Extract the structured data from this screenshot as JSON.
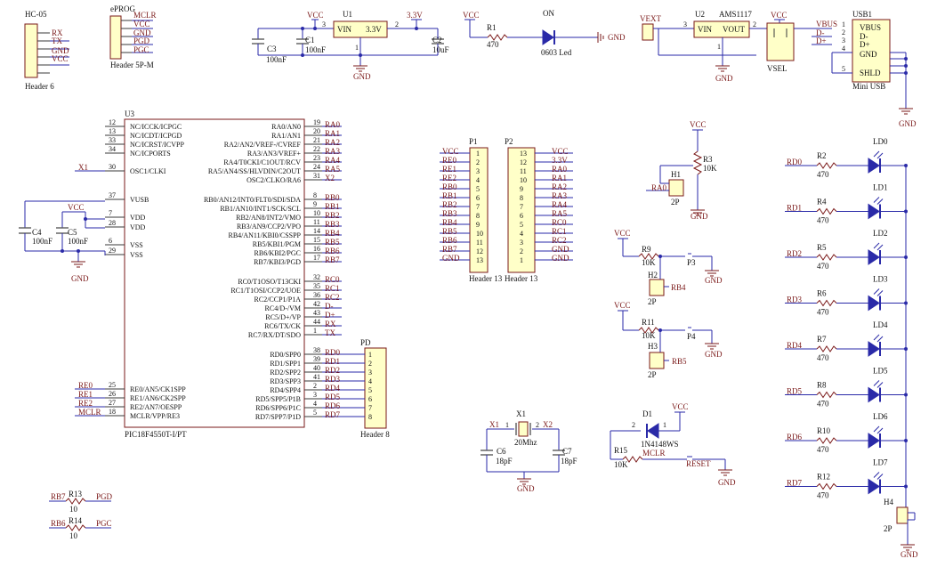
{
  "colors": {
    "wire": "#2a2aa8",
    "label": "#7a1818",
    "body": "#ffffc8",
    "background": "#ffffff"
  },
  "hc05": {
    "des": "HC-05",
    "name": "Header 6",
    "pins": [
      "RX",
      "TX",
      "GND",
      "VCC"
    ]
  },
  "eprog": {
    "des": "ePROG",
    "name": "Header 5P-M",
    "pins": [
      "MCLR",
      "VCC",
      "GND",
      "PGD",
      "PGC"
    ]
  },
  "power": {
    "vcc": "VCC",
    "gnd": "GND",
    "v33": "3.3V",
    "u1": {
      "des": "U1",
      "vin": "VIN",
      "vout": "3.3V",
      "pin_in": "3",
      "pin_out": "2",
      "pin_gnd": "1"
    },
    "c3": {
      "des": "C3",
      "val": "100nF"
    },
    "c1": {
      "des": "C1",
      "val": "100nF"
    },
    "c2": {
      "des": "C2",
      "val": "10uF"
    },
    "r1": {
      "des": "R1",
      "val": "470"
    },
    "on_led": {
      "des": "ON",
      "val": "0603 Led"
    },
    "vext": "VEXT",
    "u2": {
      "des": "U2",
      "part": "AMS1117",
      "vin": "VIN",
      "vout": "VOUT",
      "pin_in": "3",
      "pin_out": "2",
      "pin_gnd": "1"
    },
    "vsel": "VSEL",
    "vbus": "VBUS",
    "dminus": "D-",
    "dplus": "D+"
  },
  "usb": {
    "des": "USB1",
    "name": "Mini USB",
    "pins": [
      "VBUS",
      "D-",
      "D+",
      "GND",
      "SHLD"
    ],
    "pin_nums": [
      "1",
      "2",
      "3",
      "4",
      "5"
    ]
  },
  "mcu": {
    "des": "U3",
    "part": "PIC18F4550T-I/PT",
    "left_pins": [
      {
        "num": "12",
        "name": "NC/ICCK/ICPGC",
        "net": ""
      },
      {
        "num": "13",
        "name": "NC/ICDT/ICPGD",
        "net": ""
      },
      {
        "num": "33",
        "name": "NC/ICRST/ICVPP",
        "net": ""
      },
      {
        "num": "34",
        "name": "NC/ICPORTS",
        "net": ""
      },
      {
        "num": "30",
        "name": "OSC1/CLKI",
        "net": "X1"
      },
      {
        "num": "37",
        "name": "VUSB",
        "net": ""
      },
      {
        "num": "7",
        "name": "VDD",
        "net": ""
      },
      {
        "num": "28",
        "name": "VDD",
        "net": ""
      },
      {
        "num": "6",
        "name": "VSS",
        "net": ""
      },
      {
        "num": "29",
        "name": "VSS",
        "net": ""
      },
      {
        "num": "25",
        "name": "RE0/AN5/CK1SPP",
        "net": "RE0"
      },
      {
        "num": "26",
        "name": "RE1/AN6/CK2SPP",
        "net": "RE1"
      },
      {
        "num": "27",
        "name": "RE2/AN7/OESPP",
        "net": "RE2"
      },
      {
        "num": "18",
        "name": "MCLR/VPP/RE3",
        "net": "MCLR"
      }
    ],
    "right_pins": [
      {
        "num": "19",
        "name": "RA0/AN0",
        "net": "RA0"
      },
      {
        "num": "20",
        "name": "RA1/AN1",
        "net": "RA1"
      },
      {
        "num": "21",
        "name": "RA2/AN2/VREF-/CVREF",
        "net": "RA2"
      },
      {
        "num": "22",
        "name": "RA3/AN3/VREF+",
        "net": "RA3"
      },
      {
        "num": "23",
        "name": "RA4/T0CKI/C1OUT/RCV",
        "net": "RA4"
      },
      {
        "num": "24",
        "name": "RA5/AN4/SS/HLVDIN/C2OUT",
        "net": "RA5"
      },
      {
        "num": "31",
        "name": "OSC2/CLKO/RA6",
        "net": "X2"
      },
      {
        "num": "8",
        "name": "RB0/AN12/INT0/FLT0/SDI/SDA",
        "net": "RB0"
      },
      {
        "num": "9",
        "name": "RB1/AN10/INT1/SCK/SCL",
        "net": "RB1"
      },
      {
        "num": "10",
        "name": "RB2/AN8/INT2/VMO",
        "net": "RB2"
      },
      {
        "num": "11",
        "name": "RB3/AN9/CCP2/VPO",
        "net": "RB3"
      },
      {
        "num": "14",
        "name": "RB4/AN11/KBI0/CSSPP",
        "net": "RB4"
      },
      {
        "num": "15",
        "name": "RB5/KBI1/PGM",
        "net": "RB5"
      },
      {
        "num": "16",
        "name": "RB6/KBI2/PGC",
        "net": "RB6"
      },
      {
        "num": "17",
        "name": "RB7/KBI3/PGD",
        "net": "RB7"
      },
      {
        "num": "32",
        "name": "RC0/T1OSO/T13CKI",
        "net": "RC0"
      },
      {
        "num": "35",
        "name": "RC1/T1OSI/CCP2/UOE",
        "net": "RC1"
      },
      {
        "num": "36",
        "name": "RC2/CCP1/P1A",
        "net": "RC2"
      },
      {
        "num": "42",
        "name": "RC4/D-/VM",
        "net": "D-"
      },
      {
        "num": "43",
        "name": "RC5/D+/VP",
        "net": "D+"
      },
      {
        "num": "44",
        "name": "RC6/TX/CK",
        "net": "RX"
      },
      {
        "num": "1",
        "name": "RC7/RX/DT/SDO",
        "net": "TX"
      },
      {
        "num": "38",
        "name": "RD0/SPP0",
        "net": "RD0"
      },
      {
        "num": "39",
        "name": "RD1/SPP1",
        "net": "RD1"
      },
      {
        "num": "40",
        "name": "RD2/SPP2",
        "net": "RD2"
      },
      {
        "num": "41",
        "name": "RD3/SPP3",
        "net": "RD3"
      },
      {
        "num": "2",
        "name": "RD4/SPP4",
        "net": "RD4"
      },
      {
        "num": "3",
        "name": "RD5/SPP5/P1B",
        "net": "RD5"
      },
      {
        "num": "4",
        "name": "RD6/SPP6/P1C",
        "net": "RD6"
      },
      {
        "num": "5",
        "name": "RD7/SPP7/P1D",
        "net": "RD7"
      }
    ],
    "c4": {
      "des": "C4",
      "val": "100nF"
    },
    "c5": {
      "des": "C5",
      "val": "100nF"
    },
    "vcc": "VCC",
    "gnd": "GND"
  },
  "pd": {
    "des": "PD",
    "name": "Header 8",
    "pins": [
      "1",
      "2",
      "3",
      "4",
      "5",
      "6",
      "7",
      "8"
    ]
  },
  "p1": {
    "des": "P1",
    "name": "Header 13",
    "nets": [
      "VCC",
      "RE0",
      "RE1",
      "RE2",
      "RB0",
      "RB1",
      "RB2",
      "RB3",
      "RB4",
      "RB5",
      "RB6",
      "RB7",
      "GND"
    ],
    "nums": [
      "1",
      "2",
      "3",
      "4",
      "5",
      "6",
      "7",
      "8",
      "9",
      "10",
      "11",
      "12",
      "13"
    ]
  },
  "p2": {
    "des": "P2",
    "name": "Header 13",
    "nets": [
      "VCC",
      "3.3V",
      "RA0",
      "RA1",
      "RA2",
      "RA3",
      "RA4",
      "RA5",
      "RC0",
      "RC1",
      "RC2",
      "GND",
      "GND"
    ],
    "nums": [
      "13",
      "12",
      "11",
      "10",
      "9",
      "8",
      "7",
      "6",
      "5",
      "4",
      "3",
      "2",
      "1"
    ]
  },
  "pot": {
    "des": "R3",
    "val": "10K",
    "vcc": "VCC",
    "h1": "H1",
    "h1_name": "2P",
    "net": "RA0",
    "gnd": "GND"
  },
  "btn1": {
    "vcc": "VCC",
    "r": "R9",
    "val": "10K",
    "sw": "P3",
    "h": "H2",
    "h_name": "2P",
    "net": "RB4",
    "gnd": "GND"
  },
  "btn2": {
    "vcc": "VCC",
    "r": "R11",
    "val": "10K",
    "sw": "P4",
    "h": "H3",
    "h_name": "2P",
    "net": "RB5",
    "gnd": "GND"
  },
  "reset": {
    "d": "D1",
    "d_part": "1N4148WS",
    "vcc": "VCC",
    "r": "R15",
    "val": "10K",
    "net": "MCLR",
    "sw": "RESET",
    "gnd": "GND",
    "pin2": "2",
    "pin1": "1"
  },
  "crystal": {
    "des": "X1",
    "val": "20Mhz",
    "x1": "X1",
    "x2": "X2",
    "pin1": "1",
    "pin2": "2",
    "c6": "C6",
    "c6v": "18pF",
    "c7": "C7",
    "c7v": "18pF",
    "gnd": "GND"
  },
  "rpgd": {
    "net": "RB7",
    "des": "R13",
    "val": "10",
    "out": "PGD"
  },
  "rpgc": {
    "net": "RB6",
    "des": "R14",
    "val": "10",
    "out": "PGC"
  },
  "leds": [
    {
      "net": "RD0",
      "r": "R2",
      "val": "470",
      "led": "LD0"
    },
    {
      "net": "RD1",
      "r": "R4",
      "val": "470",
      "led": "LD1"
    },
    {
      "net": "RD2",
      "r": "R5",
      "val": "470",
      "led": "LD2"
    },
    {
      "net": "RD3",
      "r": "R6",
      "val": "470",
      "led": "LD3"
    },
    {
      "net": "RD4",
      "r": "R7",
      "val": "470",
      "led": "LD4"
    },
    {
      "net": "RD5",
      "r": "R8",
      "val": "470",
      "led": "LD5"
    },
    {
      "net": "RD6",
      "r": "R10",
      "val": "470",
      "led": "LD6"
    },
    {
      "net": "RD7",
      "r": "R12",
      "val": "470",
      "led": "LD7"
    }
  ],
  "h4": {
    "des": "H4",
    "name": "2P",
    "gnd": "GND"
  }
}
